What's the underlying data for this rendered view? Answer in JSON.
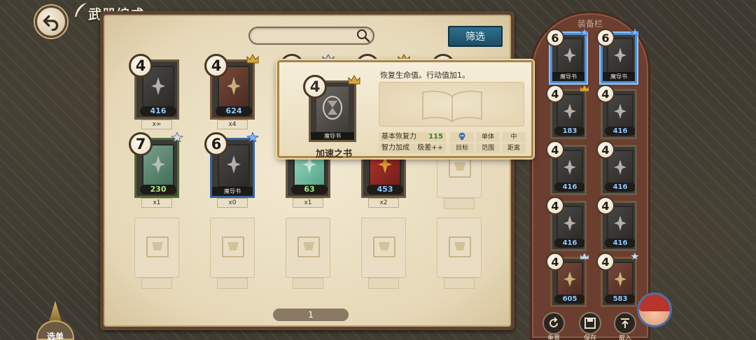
{
  "header": {
    "title": "武器编成"
  },
  "search": {
    "placeholder": ""
  },
  "filter_label": "筛选",
  "grid_cards": [
    {
      "cost": "4",
      "power": "416",
      "qty": "x∞",
      "rank": "",
      "style": "dark"
    },
    {
      "cost": "4",
      "power": "624",
      "qty": "x4",
      "rank": "crown",
      "style": "brown"
    },
    {
      "cost": "4",
      "power": "",
      "qty": "",
      "rank": "crown-silver",
      "style": "dark"
    },
    {
      "cost": "3",
      "power": "",
      "qty": "",
      "rank": "crown",
      "style": "dark"
    },
    {
      "cost": "5",
      "power": "",
      "qty": "",
      "rank": "",
      "style": "dark"
    },
    {
      "cost": "7",
      "power": "230",
      "qty": "x1",
      "rank": "star-silver",
      "style": "green"
    },
    {
      "cost": "6",
      "power": "",
      "qty": "x0",
      "rank": "star-blue",
      "style": "blue",
      "label": "魔导书"
    },
    {
      "cost": "",
      "power": "63",
      "qty": "x1",
      "rank": "",
      "style": "teal"
    },
    {
      "cost": "",
      "power": "453",
      "qty": "x2",
      "rank": "",
      "style": "red"
    }
  ],
  "pagination": {
    "page": "1"
  },
  "tooltip": {
    "cost": "4",
    "name": "加速之书",
    "card_label": "魔导书",
    "description": "恢复生命值。行动值加1。",
    "stats": [
      {
        "label": "基本恢复力",
        "value": "115"
      },
      {
        "label": "智力加成",
        "value": "极差++"
      }
    ],
    "attrs_top": [
      "单体",
      "中"
    ],
    "attrs_bottom": [
      "目标",
      "范围",
      "距离"
    ]
  },
  "equip": {
    "title": "装备栏",
    "slots": [
      {
        "cost": "6",
        "power": "",
        "label": "魔导书",
        "rank": "star-blue",
        "style": "blue"
      },
      {
        "cost": "6",
        "power": "",
        "label": "魔导书",
        "rank": "star-blue",
        "style": "blue"
      },
      {
        "cost": "4",
        "power": "183",
        "label": "",
        "rank": "crown",
        "style": "dark"
      },
      {
        "cost": "4",
        "power": "416",
        "label": "",
        "rank": "",
        "style": "dark"
      },
      {
        "cost": "4",
        "power": "416",
        "label": "",
        "rank": "",
        "style": "dark"
      },
      {
        "cost": "4",
        "power": "416",
        "label": "",
        "rank": "",
        "style": "dark"
      },
      {
        "cost": "4",
        "power": "416",
        "label": "",
        "rank": "",
        "style": "dark"
      },
      {
        "cost": "4",
        "power": "416",
        "label": "",
        "rank": "",
        "style": "dark"
      },
      {
        "cost": "4",
        "power": "605",
        "label": "",
        "rank": "crown-silver",
        "style": "brown"
      },
      {
        "cost": "4",
        "power": "583",
        "label": "",
        "rank": "star-silver",
        "style": "brown"
      }
    ],
    "actions": {
      "reset": "重置",
      "save": "保存",
      "load": "载入"
    }
  },
  "menu_label": "选单"
}
